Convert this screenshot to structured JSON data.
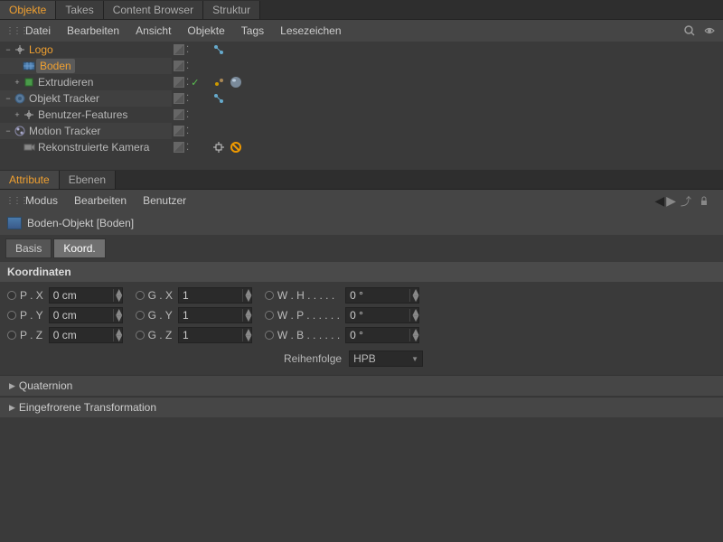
{
  "top_tabs": [
    "Objekte",
    "Takes",
    "Content Browser",
    "Struktur"
  ],
  "top_tabs_active": 0,
  "top_menu": [
    "Datei",
    "Bearbeiten",
    "Ansicht",
    "Objekte",
    "Tags",
    "Lesezeichen"
  ],
  "tree": [
    {
      "label": "Logo",
      "level": 0,
      "expander": "−",
      "icon": "null-icon",
      "orange": true,
      "selected": false,
      "checkmark": false
    },
    {
      "label": "Boden",
      "level": 1,
      "expander": "",
      "icon": "floor-icon",
      "orange": true,
      "selected": true,
      "checkmark": false
    },
    {
      "label": "Extrudieren",
      "level": 1,
      "expander": "+",
      "icon": "extrude-icon",
      "orange": false,
      "selected": false,
      "checkmark": true
    },
    {
      "label": "Objekt Tracker",
      "level": 0,
      "expander": "−",
      "icon": "tracker-icon",
      "orange": false,
      "selected": false,
      "checkmark": false
    },
    {
      "label": "Benutzer-Features",
      "level": 1,
      "expander": "+",
      "icon": "null-icon",
      "orange": false,
      "selected": false,
      "checkmark": false
    },
    {
      "label": "Motion Tracker",
      "level": 0,
      "expander": "−",
      "icon": "motion-icon",
      "orange": false,
      "selected": false,
      "checkmark": false
    },
    {
      "label": "Rekonstruierte Kamera",
      "level": 1,
      "expander": "",
      "icon": "camera-icon",
      "orange": false,
      "selected": false,
      "checkmark": false
    }
  ],
  "bottom_tabs": [
    "Attribute",
    "Ebenen"
  ],
  "bottom_tabs_active": 0,
  "bottom_menu": [
    "Modus",
    "Bearbeiten",
    "Benutzer"
  ],
  "attr_title": "Boden-Objekt [Boden]",
  "sub_tabs": [
    "Basis",
    "Koord."
  ],
  "sub_tabs_active": 1,
  "section_title": "Koordinaten",
  "coords": {
    "px": {
      "label": "P . X",
      "value": "0 cm"
    },
    "gx": {
      "label": "G . X",
      "value": "1"
    },
    "wh": {
      "label": "W . H . . . . .",
      "value": "0 °"
    },
    "py": {
      "label": "P . Y",
      "value": "0 cm"
    },
    "gy": {
      "label": "G . Y",
      "value": "1"
    },
    "wp": {
      "label": "W . P . . . . . .",
      "value": "0 °"
    },
    "pz": {
      "label": "P . Z",
      "value": "0 cm"
    },
    "gz": {
      "label": "G . Z",
      "value": "1"
    },
    "wb": {
      "label": "W . B . . . . . .",
      "value": "0 °"
    }
  },
  "order": {
    "label": "Reihenfolge",
    "value": "HPB"
  },
  "collapse_sections": [
    "Quaternion",
    "Eingefrorene Transformation"
  ]
}
